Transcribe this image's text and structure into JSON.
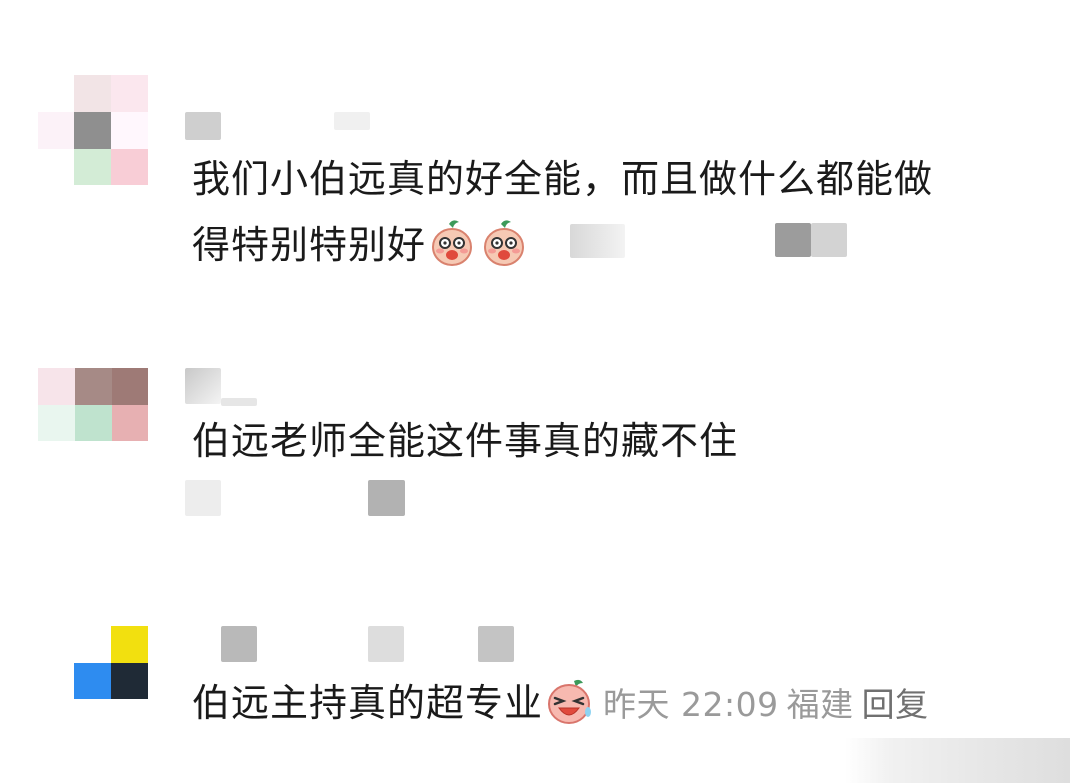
{
  "comments": [
    {
      "text_line1": "我们小伯远真的好全能，而且做什么都能做",
      "text_line2": "得特别特别好",
      "emojis": [
        "shy-cheeks-emoji",
        "shy-cheeks-emoji"
      ]
    },
    {
      "text_line1": "伯远老师全能这件事真的藏不住"
    },
    {
      "text_line1": "伯远主持真的超专业",
      "emojis": [
        "laughing-cry-emoji"
      ],
      "time": "昨天 22:09",
      "location": "福建",
      "reply_label": "回复"
    }
  ],
  "colors": {
    "text": "#1a1a1a",
    "meta": "#9a9a9a",
    "reply": "#707070",
    "avatar3_yellow": "#f2e00f",
    "avatar3_blue": "#2e8cf0",
    "avatar3_dark": "#1f2a36"
  }
}
